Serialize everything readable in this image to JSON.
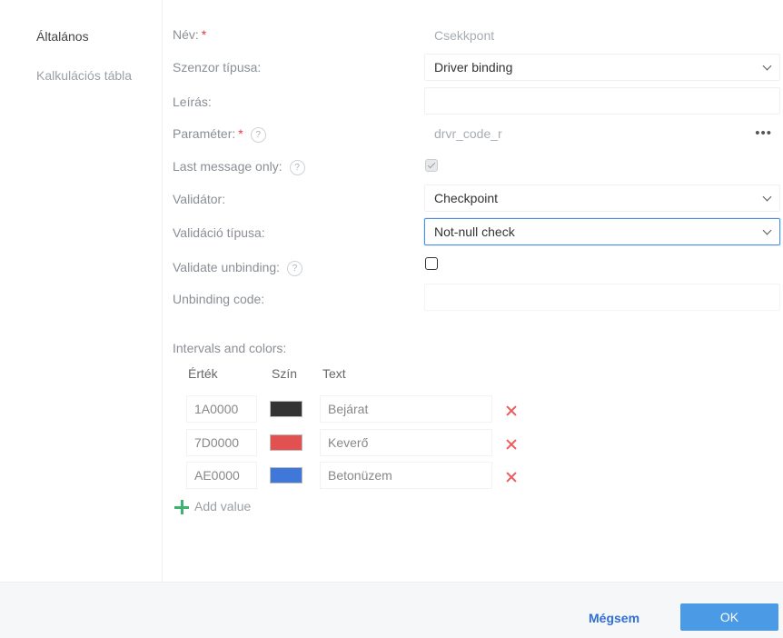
{
  "sidebar": {
    "items": [
      {
        "label": "Általános"
      },
      {
        "label": "Kalkulációs tábla"
      }
    ]
  },
  "form": {
    "name_label": "Név:",
    "name_value": "Csekkpont",
    "sensor_type_label": "Szenzor típusa:",
    "sensor_type_value": "Driver binding",
    "description_label": "Leírás:",
    "parameter_label": "Paraméter:",
    "parameter_value": "drvr_code_r",
    "last_message_label": "Last message only:",
    "last_message_checked": true,
    "validator_label": "Validátor:",
    "validator_value": "Checkpoint",
    "validation_type_label": "Validáció típusa:",
    "validation_type_value": "Not-null check",
    "validate_unbinding_label": "Validate unbinding:",
    "validate_unbinding_checked": false,
    "unbinding_code_label": "Unbinding code:",
    "required_mark": "*",
    "help_mark": "?"
  },
  "intervals": {
    "title": "Intervals and colors:",
    "headers": {
      "value": "Érték",
      "color": "Szín",
      "text": "Text"
    },
    "rows": [
      {
        "value": "1A0000",
        "color": "#333333",
        "text": "Bejárat"
      },
      {
        "value": "7D0000",
        "color": "#e35050",
        "text": "Keverő"
      },
      {
        "value": "AE0000",
        "color": "#3f78d8",
        "text": "Betonüzem"
      }
    ],
    "add_label": "Add value"
  },
  "footer": {
    "cancel_label": "Mégsem",
    "ok_label": "OK"
  }
}
